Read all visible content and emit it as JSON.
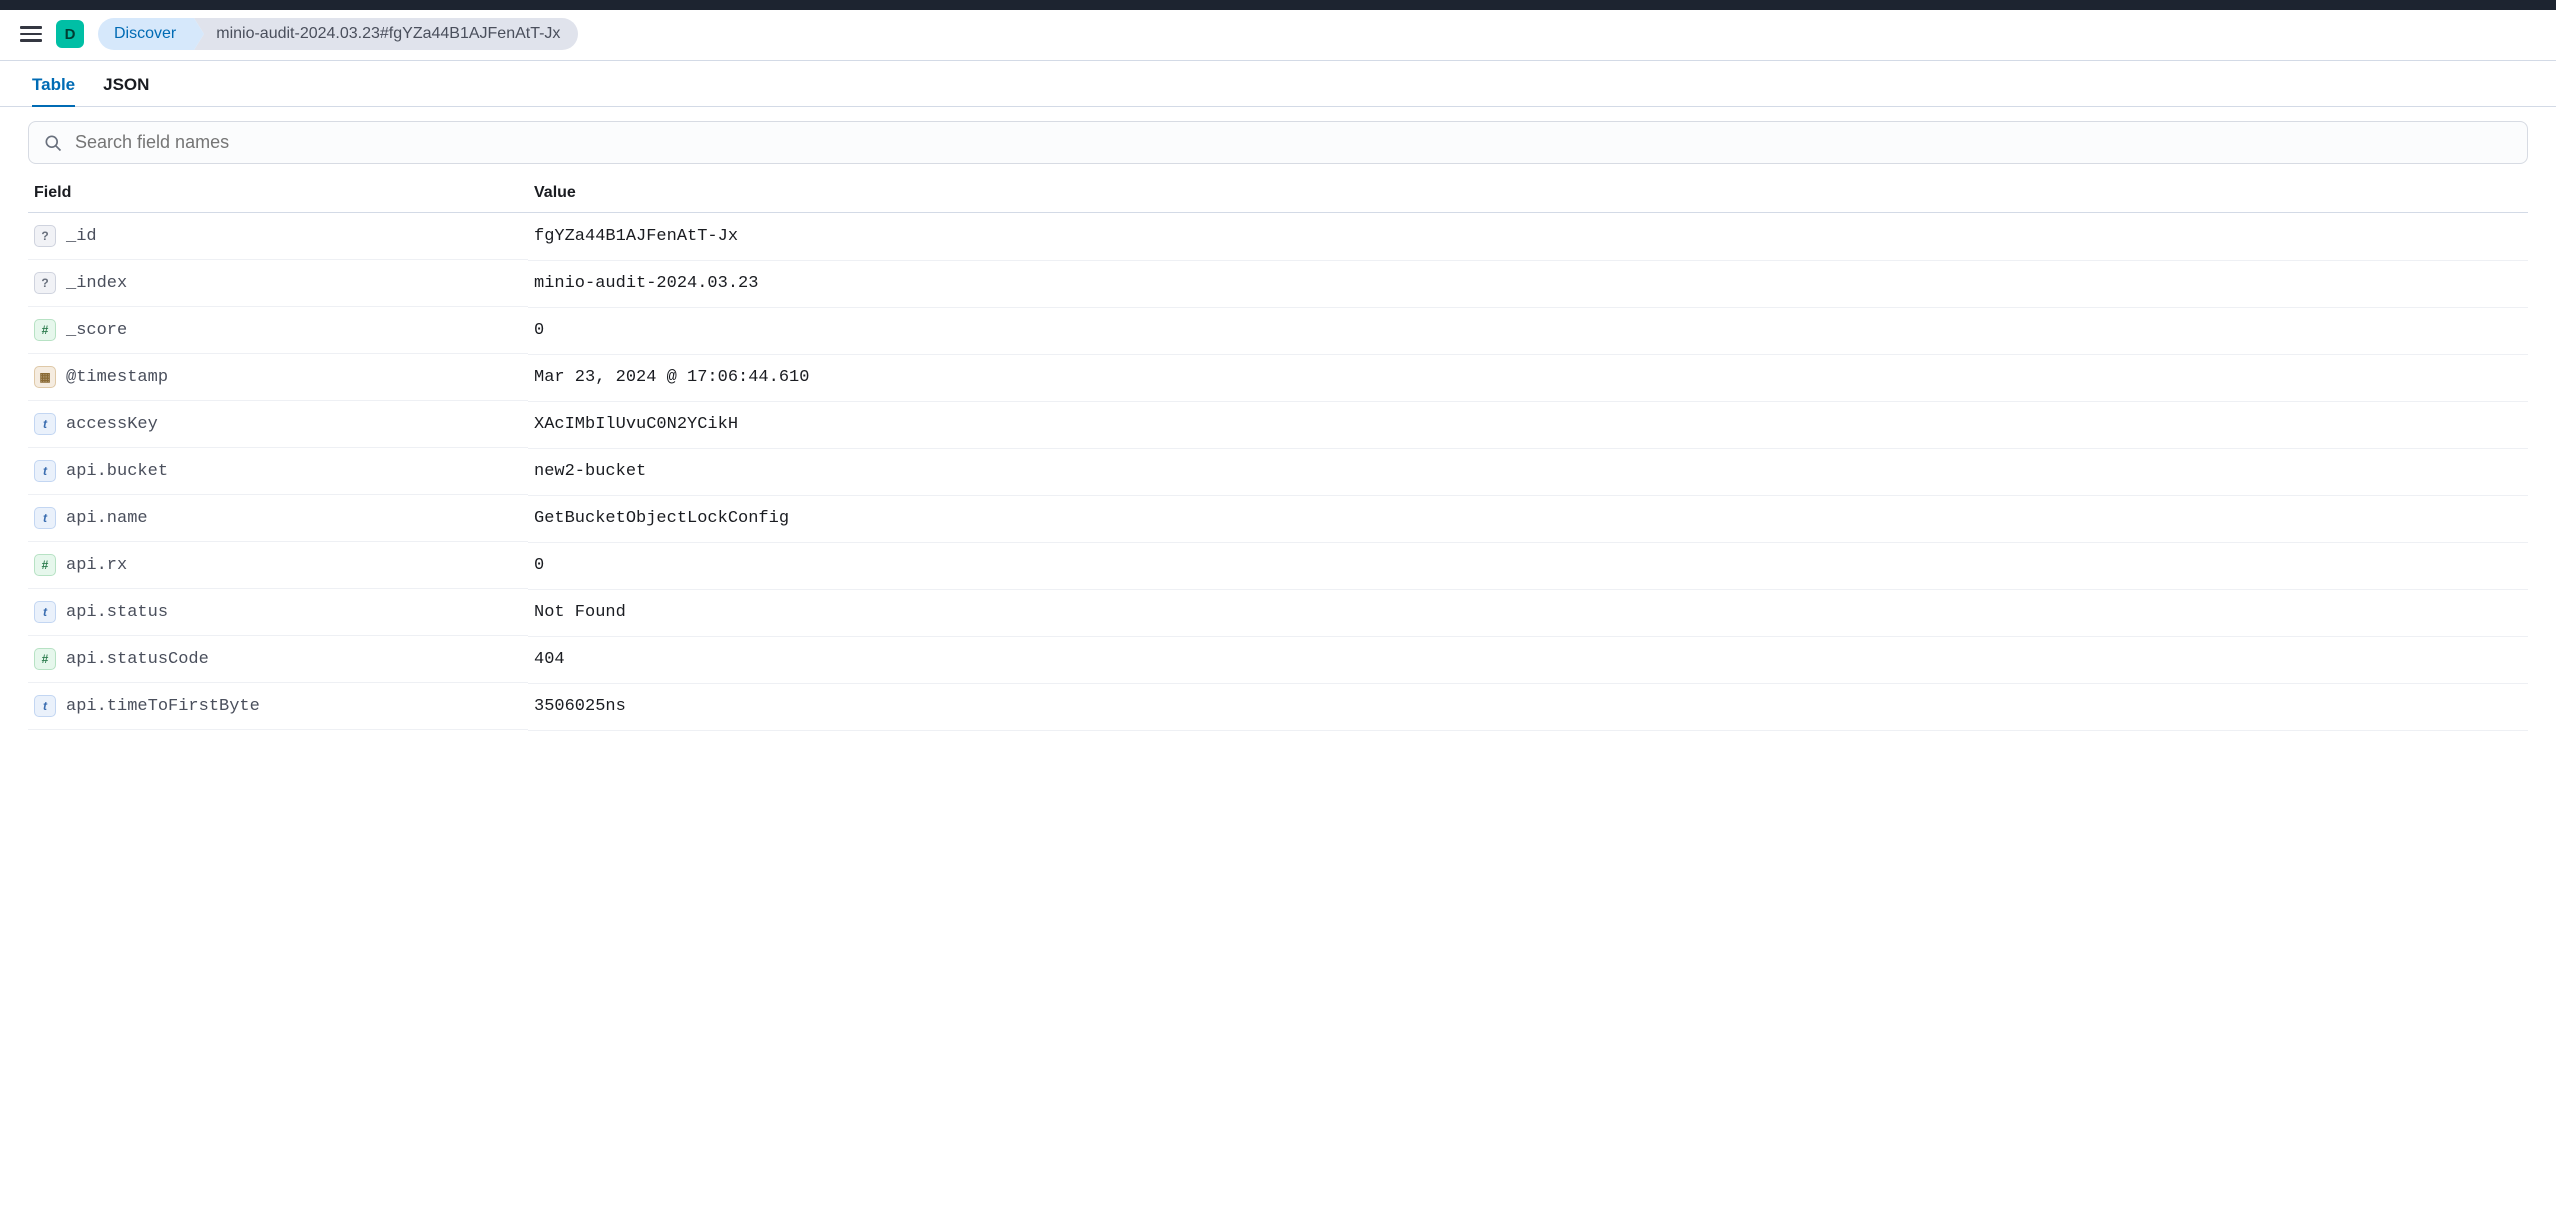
{
  "logo_letter": "D",
  "breadcrumbs": {
    "first": "Discover",
    "second": "minio-audit-2024.03.23#fgYZa44B1AJFenAtT-Jx"
  },
  "tabs": {
    "table": "Table",
    "json": "JSON"
  },
  "search": {
    "placeholder": "Search field names"
  },
  "table": {
    "field_header": "Field",
    "value_header": "Value",
    "rows": [
      {
        "type": "unknown",
        "type_label": "?",
        "field": "_id",
        "value": "fgYZa44B1AJFenAtT-Jx"
      },
      {
        "type": "unknown",
        "type_label": "?",
        "field": "_index",
        "value": "minio-audit-2024.03.23"
      },
      {
        "type": "number",
        "type_label": "#",
        "field": "_score",
        "value": "0"
      },
      {
        "type": "date",
        "type_label": "▦",
        "field": "@timestamp",
        "value": "Mar 23, 2024 @ 17:06:44.610"
      },
      {
        "type": "text",
        "type_label": "t",
        "field": "accessKey",
        "value": "XAcIMbIlUvuC0N2YCikH"
      },
      {
        "type": "text",
        "type_label": "t",
        "field": "api.bucket",
        "value": "new2-bucket"
      },
      {
        "type": "text",
        "type_label": "t",
        "field": "api.name",
        "value": "GetBucketObjectLockConfig"
      },
      {
        "type": "number",
        "type_label": "#",
        "field": "api.rx",
        "value": "0"
      },
      {
        "type": "text",
        "type_label": "t",
        "field": "api.status",
        "value": "Not Found"
      },
      {
        "type": "number",
        "type_label": "#",
        "field": "api.statusCode",
        "value": "404"
      },
      {
        "type": "text",
        "type_label": "t",
        "field": "api.timeToFirstByte",
        "value": "3506025ns"
      }
    ]
  }
}
